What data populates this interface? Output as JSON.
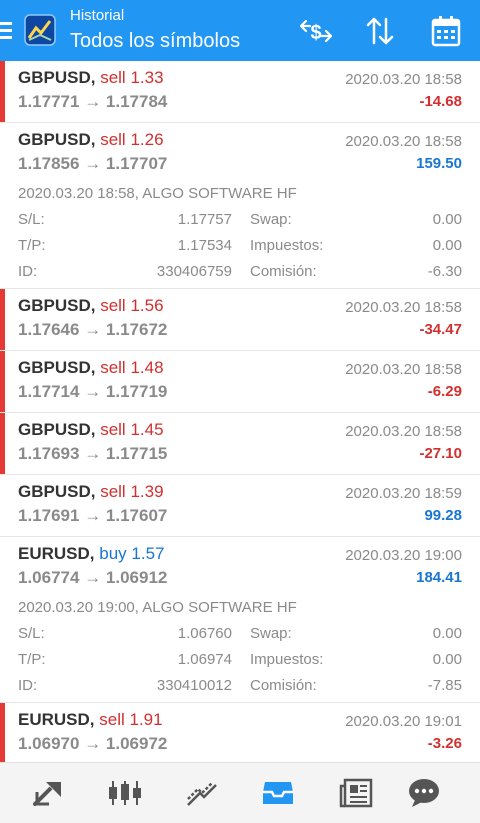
{
  "header": {
    "subtitle": "Historial",
    "title": "Todos los símbolos",
    "icons": [
      "menu-icon",
      "app-logo-icon",
      "currency-icon",
      "sort-icon",
      "calendar-icon"
    ]
  },
  "trades": [
    {
      "symbol": "GBPUSD,",
      "type": "sell",
      "volume": "1.33",
      "open_price": "1.17771",
      "close_price": "1.17784",
      "time": "2020.03.20 18:58",
      "profit": "-14.68",
      "marked": true
    },
    {
      "symbol": "GBPUSD,",
      "type": "sell",
      "volume": "1.26",
      "open_price": "1.17856",
      "close_price": "1.17707",
      "time": "2020.03.20 18:58",
      "profit": "159.50",
      "marked": false,
      "detail": {
        "line": "2020.03.20 18:58, ALGO SOFTWARE HF",
        "sl_label": "S/L:",
        "sl": "1.17757",
        "tp_label": "T/P:",
        "tp": "1.17534",
        "id_label": "ID:",
        "id": "330406759",
        "swap_label": "Swap:",
        "swap": "0.00",
        "tax_label": "Impuestos:",
        "tax": "0.00",
        "commission_label": "Comisión:",
        "commission": "-6.30"
      }
    },
    {
      "symbol": "GBPUSD,",
      "type": "sell",
      "volume": "1.56",
      "open_price": "1.17646",
      "close_price": "1.17672",
      "time": "2020.03.20 18:58",
      "profit": "-34.47",
      "marked": true
    },
    {
      "symbol": "GBPUSD,",
      "type": "sell",
      "volume": "1.48",
      "open_price": "1.17714",
      "close_price": "1.17719",
      "time": "2020.03.20 18:58",
      "profit": "-6.29",
      "marked": true
    },
    {
      "symbol": "GBPUSD,",
      "type": "sell",
      "volume": "1.45",
      "open_price": "1.17693",
      "close_price": "1.17715",
      "time": "2020.03.20 18:58",
      "profit": "-27.10",
      "marked": true
    },
    {
      "symbol": "GBPUSD,",
      "type": "sell",
      "volume": "1.39",
      "open_price": "1.17691",
      "close_price": "1.17607",
      "time": "2020.03.20 18:59",
      "profit": "99.28",
      "marked": false
    },
    {
      "symbol": "EURUSD,",
      "type": "buy",
      "volume": "1.57",
      "open_price": "1.06774",
      "close_price": "1.06912",
      "time": "2020.03.20 19:00",
      "profit": "184.41",
      "marked": false,
      "detail": {
        "line": "2020.03.20 19:00, ALGO SOFTWARE HF",
        "sl_label": "S/L:",
        "sl": "1.06760",
        "tp_label": "T/P:",
        "tp": "1.06974",
        "id_label": "ID:",
        "id": "330410012",
        "swap_label": "Swap:",
        "swap": "0.00",
        "tax_label": "Impuestos:",
        "tax": "0.00",
        "commission_label": "Comisión:",
        "commission": "-7.85"
      }
    },
    {
      "symbol": "EURUSD,",
      "type": "sell",
      "volume": "1.91",
      "open_price": "1.06970",
      "close_price": "1.06972",
      "time": "2020.03.20 19:01",
      "profit": "-3.26",
      "marked": true
    }
  ],
  "arrow": "→",
  "bottom_nav": [
    "quotes-icon",
    "chart-icon",
    "trade-icon",
    "history-icon",
    "news-icon",
    "chat-icon"
  ],
  "colors": {
    "header": "#2196f3",
    "sell": "#d32f2f",
    "buy": "#1976d2",
    "loss_marker": "#e53935",
    "active_nav": "#2196f3"
  }
}
